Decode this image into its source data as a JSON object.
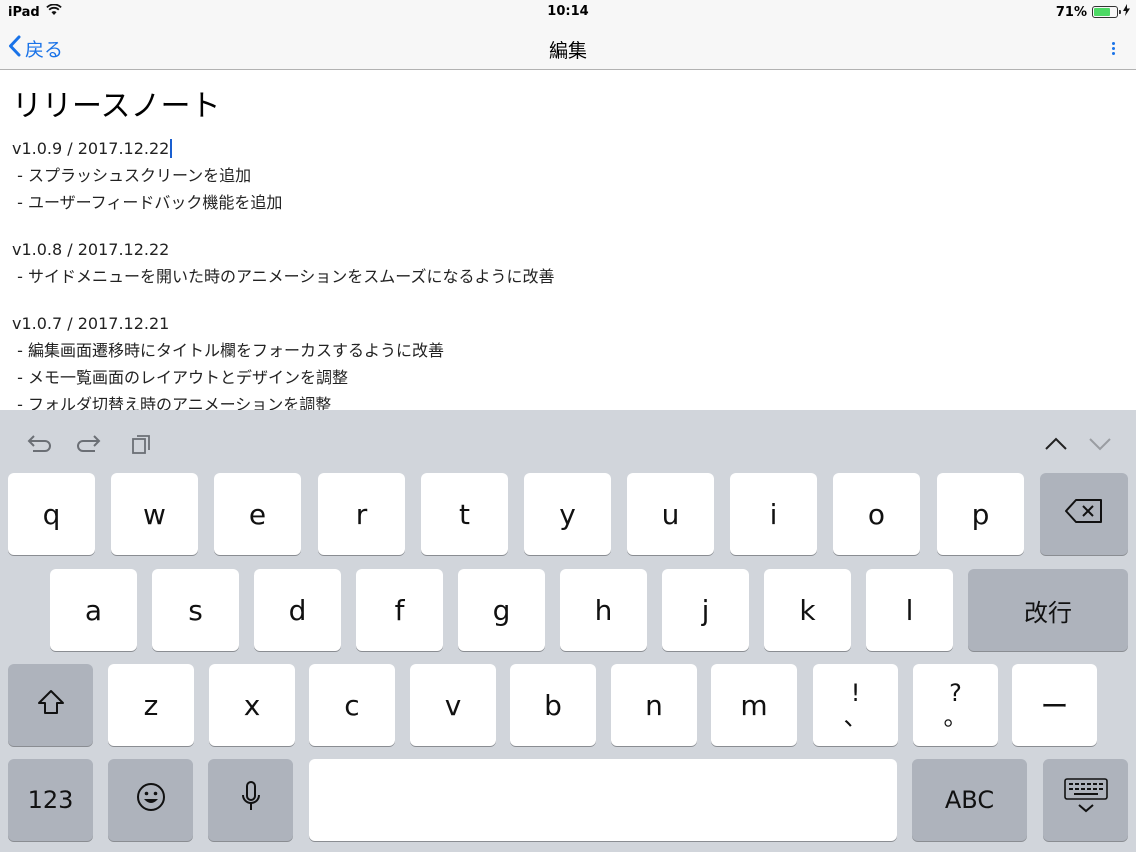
{
  "status_bar": {
    "device": "iPad",
    "time": "10:14",
    "battery_percent": "71%",
    "battery_level": 0.71,
    "icons": [
      "wifi-icon",
      "battery-icon",
      "charging-bolt-icon"
    ]
  },
  "nav": {
    "back_label": "戻る",
    "title": "編集",
    "back_icon": "chevron-left-icon",
    "more_icon": "vertical-ellipsis-icon",
    "accent_color": "#1a73e8"
  },
  "note": {
    "title": "リリースノート",
    "sections": [
      {
        "version": "v1.0.9 / 2017.12.22",
        "items": [
          " - スプラッシュスクリーンを追加",
          " - ユーザーフィードバック機能を追加"
        ]
      },
      {
        "version": "v1.0.8 / 2017.12.22",
        "items": [
          " - サイドメニューを開いた時のアニメーションをスムーズになるように改善"
        ]
      },
      {
        "version": "v1.0.7 / 2017.12.21",
        "items": [
          " - 編集画面遷移時にタイトル欄をフォーカスするように改善",
          " - メモ一覧画面のレイアウトとデザインを調整",
          " - フォルダ切替え時のアニメーションを調整"
        ]
      }
    ]
  },
  "keyboard": {
    "assist_icons": [
      "undo-icon",
      "redo-icon",
      "paste-icon",
      "chevron-up-icon",
      "chevron-down-icon"
    ],
    "row1": [
      "q",
      "w",
      "e",
      "r",
      "t",
      "y",
      "u",
      "i",
      "o",
      "p"
    ],
    "row2": [
      "a",
      "s",
      "d",
      "f",
      "g",
      "h",
      "j",
      "k",
      "l"
    ],
    "row3": [
      "z",
      "x",
      "c",
      "v",
      "b",
      "n",
      "m"
    ],
    "punct1_top": "!",
    "punct1_bottom": "、",
    "punct2_top": "?",
    "punct2_bottom": "。",
    "dash_label": "ー",
    "return_label": "改行",
    "numbers_label": "123",
    "abc_label": "ABC",
    "space_label": "",
    "icons": [
      "delete-icon",
      "shift-icon",
      "emoji-icon",
      "microphone-icon",
      "keyboard-dismiss-icon"
    ]
  }
}
